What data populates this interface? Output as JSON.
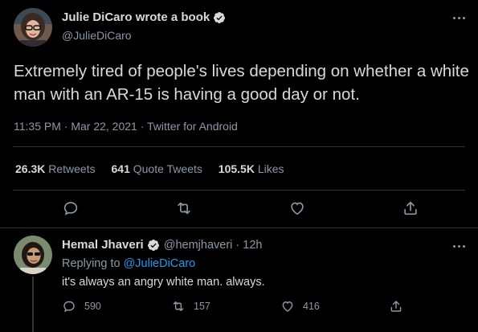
{
  "colors": {
    "background": "#000000",
    "text": "#d9d9d9",
    "muted": "#8b98a5",
    "divider": "#2f3336",
    "accent": "#1d9bf0"
  },
  "main_tweet": {
    "author": {
      "display_name": "Julie DiCaro wrote a book",
      "handle": "@JulieDiCaro",
      "verified": true
    },
    "text": "Extremely tired of people's lives depending on whether a white man with an AR-15 is having a good day or not.",
    "meta": "11:35 PM · Mar 22, 2021 · Twitter for Android",
    "stats": {
      "retweets_count": "26.3K",
      "retweets_label": "Retweets",
      "quotes_count": "641",
      "quotes_label": "Quote Tweets",
      "likes_count": "105.5K",
      "likes_label": "Likes"
    },
    "actions": [
      "reply-icon",
      "retweet-icon",
      "like-icon",
      "share-icon"
    ]
  },
  "reply": {
    "author": {
      "display_name": "Hemal Jhaveri",
      "handle_time": "@hemjhaveri · 12h",
      "verified": true
    },
    "replying_prefix": "Replying to",
    "replying_handle": "@JulieDiCaro",
    "text": "it's always an angry white man. always.",
    "counts": {
      "replies": "590",
      "retweets": "157",
      "likes": "416"
    }
  }
}
